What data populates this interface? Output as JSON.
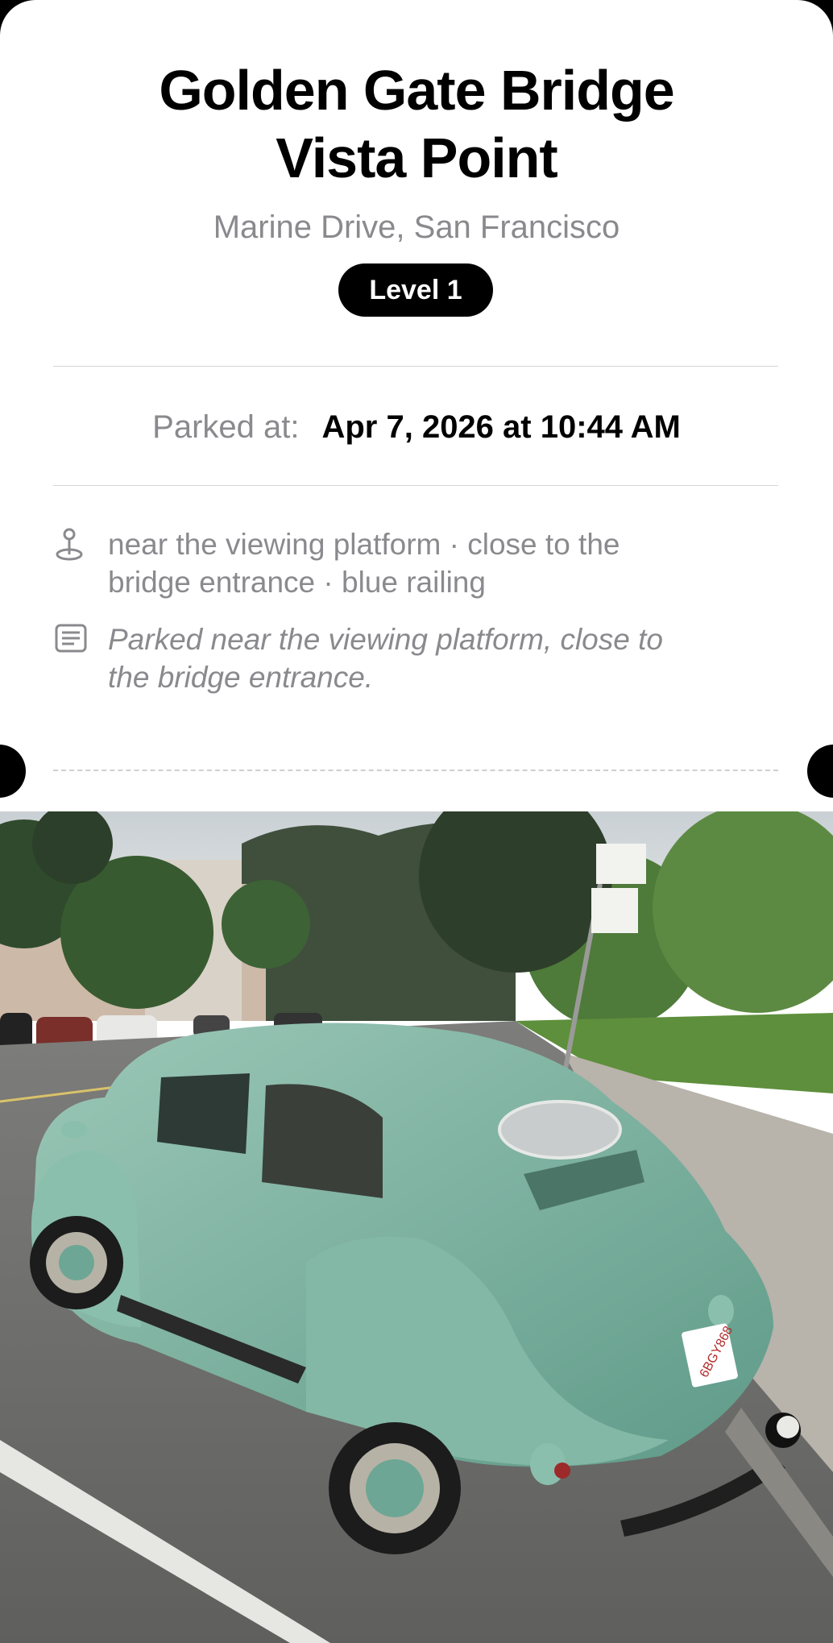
{
  "place": {
    "title_line1": "Golden Gate Bridge",
    "title_line2": "Vista Point",
    "address": "Marine Drive, San Francisco",
    "level": "Level 1"
  },
  "parked": {
    "label": "Parked at:",
    "value": "Apr 7, 2026 at 10:44 AM"
  },
  "landmarks": {
    "icon": "map-pin-icon",
    "line1": "near the viewing platform · close to the",
    "line2": "bridge entrance · blue railing"
  },
  "note": {
    "icon": "note-icon",
    "line1": "Parked near the viewing platform, close to",
    "line2": "the bridge entrance."
  },
  "photo": {
    "subject": "parked-car-photo",
    "plate": "6BGY868"
  },
  "colors": {
    "background": "#ffffff",
    "text_primary": "#000000",
    "text_secondary": "#8a8a8e",
    "badge_bg": "#000000",
    "badge_text": "#ffffff",
    "car": "#7fb5a3"
  }
}
